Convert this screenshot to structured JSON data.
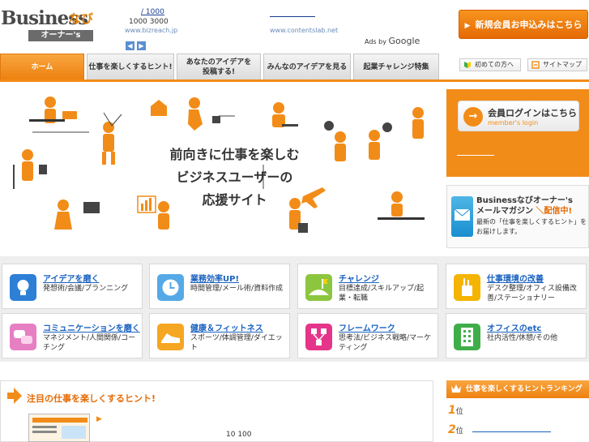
{
  "header": {
    "logo_main": "Business",
    "logo_navi": "なび",
    "logo_sub": "オーナー's",
    "ad1": {
      "title": "/ 1000",
      "numbers": "1000 3000",
      "url": "www.bizreach.jp"
    },
    "ad2": {
      "url": "www.contentslab.net"
    },
    "ads_by": "Ads by",
    "ads_google": "Google",
    "signup_label": "新規会員お申込みはこちら",
    "signup_arrow": "▶"
  },
  "nav": {
    "items": [
      {
        "label": "ホーム"
      },
      {
        "label": "仕事を楽しくするヒント!"
      },
      {
        "label": "あなたのアイデアを\n投稿する!"
      },
      {
        "label": "みんなのアイデアを見る"
      },
      {
        "label": "起業チャレンジ特集"
      }
    ],
    "util": [
      {
        "label": "初めての方へ"
      },
      {
        "label": "サイトマップ"
      }
    ]
  },
  "hero": {
    "line1": "前向きに仕事を楽しむ",
    "line2": "ビジネスユーザーの",
    "line3": "応援サイト"
  },
  "login": {
    "title": "会員ログインはこちら",
    "sub": "member's login",
    "arrow": "→"
  },
  "magazine": {
    "title": "Businessなびオーナー's",
    "sub_prefix": "メールマガジン",
    "sub_badge": "＼配信中!",
    "desc": "最新の「仕事を楽しくするヒント」をお届けします。"
  },
  "categories": [
    {
      "title": "アイデアを磨く",
      "desc": "発想術/会議/プランニング",
      "color": "#2e7fd6"
    },
    {
      "title": "業務効率UP!",
      "desc": "時間管理/メール術/資料作成",
      "color": "#55a9e6"
    },
    {
      "title": "チャレンジ",
      "desc": "目標達成/スキルアップ/起業・転職",
      "color": "#8cc63f"
    },
    {
      "title": "仕事環境の改善",
      "desc": "デスク整理/オフィス設備改善/ステーショナリー",
      "color": "#f4b400"
    },
    {
      "title": "コミュニケーションを磨く",
      "desc": "マネジメント/人間関係/コーチング",
      "color": "#e77fc3"
    },
    {
      "title": "健康＆フィットネス",
      "desc": "スポーツ/体調管理/ダイエット",
      "color": "#f5a623"
    },
    {
      "title": "フレームワーク",
      "desc": "思考法/ビジネス戦略/マーケティング",
      "color": "#e5358a"
    },
    {
      "title": "オフィスのetc",
      "desc": "社内活性/休憩/その他",
      "color": "#3fae49"
    }
  ],
  "hints": {
    "title": "注目の仕事を楽しくするヒント!",
    "play": "▶",
    "numbers": "10 100"
  },
  "ranking": {
    "title": "仕事を楽しくするヒントランキング",
    "items": [
      {
        "num": "1",
        "suffix": "位"
      },
      {
        "num": "2",
        "suffix": "位"
      }
    ]
  },
  "colors": {
    "accent": "#f28c18",
    "link": "#1a62c0"
  }
}
